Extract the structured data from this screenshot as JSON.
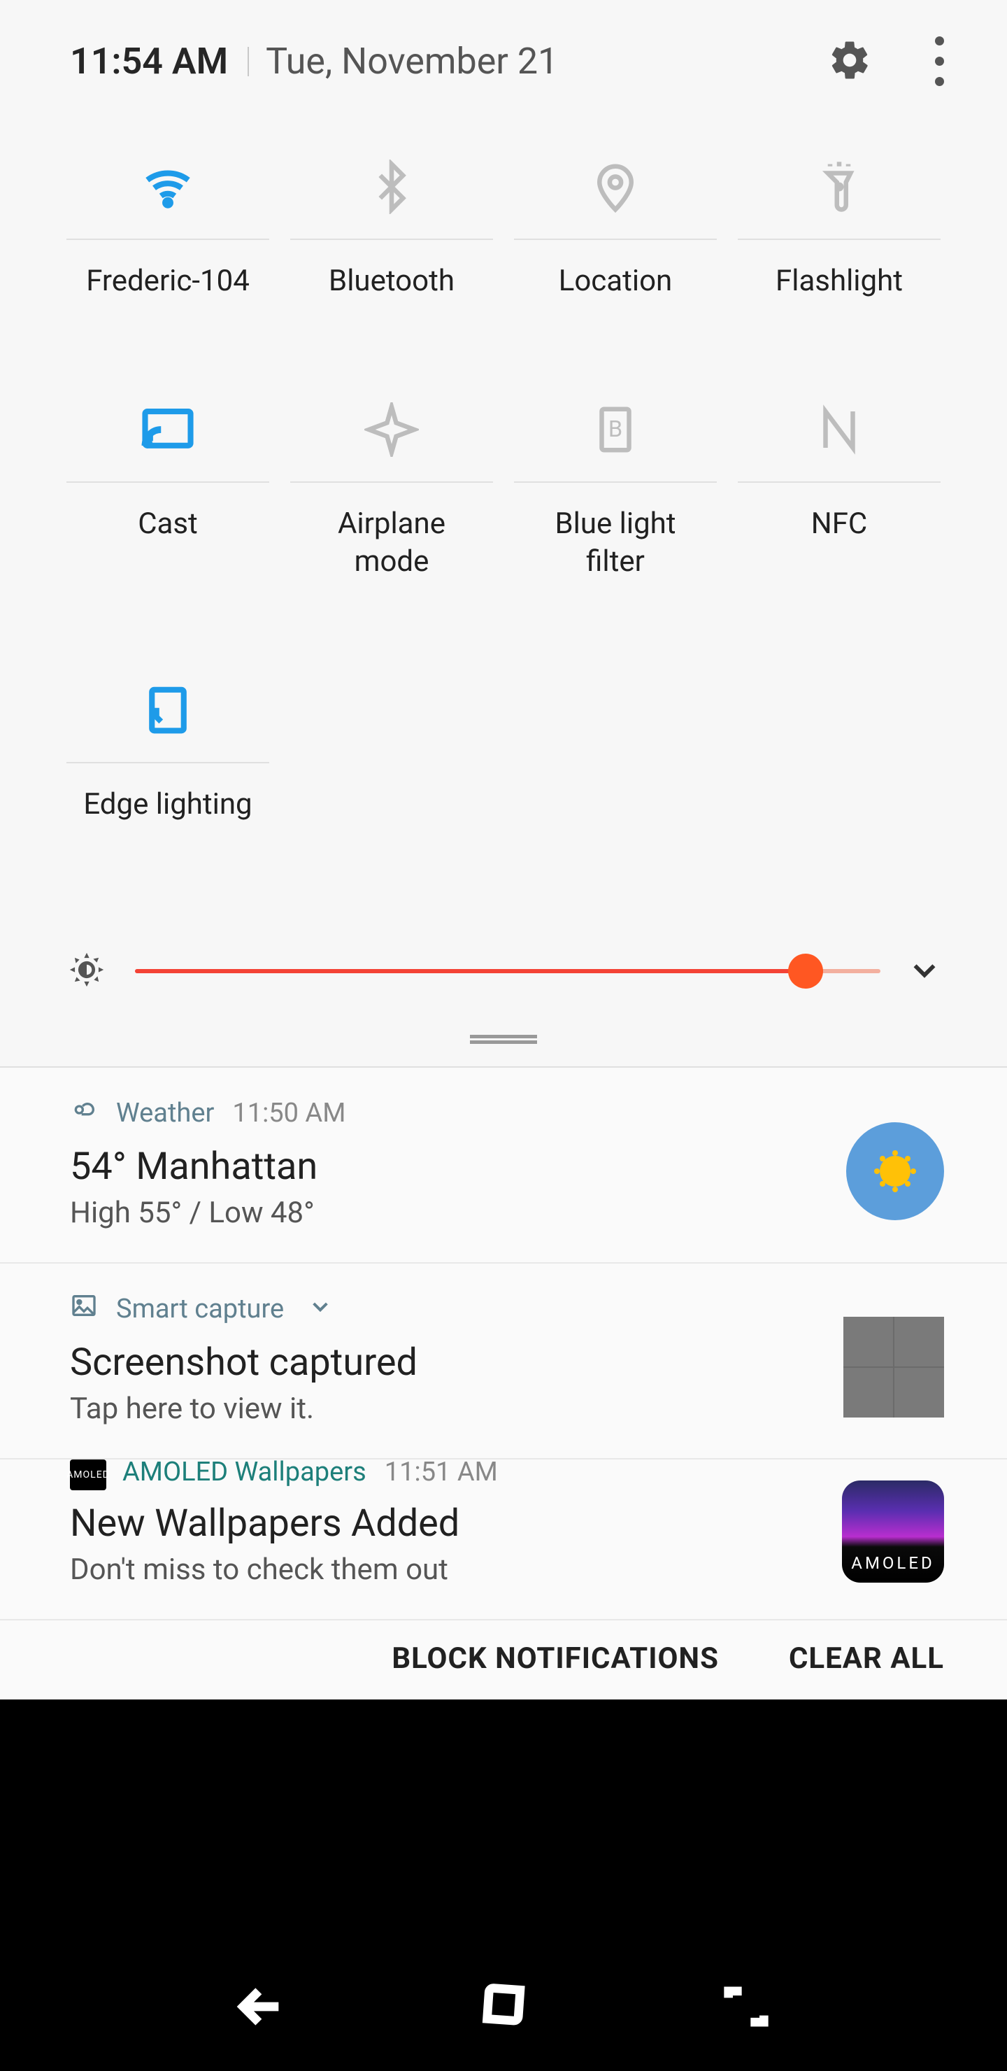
{
  "header": {
    "time": "11:54 AM",
    "date": "Tue, November 21"
  },
  "qs": {
    "tiles": [
      {
        "label": "Frederic-104",
        "icon": "wifi",
        "active": true
      },
      {
        "label": "Bluetooth",
        "icon": "bluetooth",
        "active": false
      },
      {
        "label": "Location",
        "icon": "location",
        "active": false
      },
      {
        "label": "Flashlight",
        "icon": "flashlight",
        "active": false
      },
      {
        "label": "Cast",
        "icon": "cast",
        "active": true
      },
      {
        "label": "Airplane\nmode",
        "icon": "airplane",
        "active": false
      },
      {
        "label": "Blue light\nfilter",
        "icon": "bluelight",
        "active": false
      },
      {
        "label": "NFC",
        "icon": "nfc",
        "active": false
      },
      {
        "label": "Edge lighting",
        "icon": "edge",
        "active": true
      }
    ]
  },
  "brightness": {
    "percent": 90
  },
  "notifications": [
    {
      "app": "Weather",
      "time": "11:50 AM",
      "title": "54° Manhattan",
      "text": "High 55° / Low 48°",
      "kind": "weather"
    },
    {
      "app": "Smart capture",
      "time": "",
      "title": "Screenshot captured",
      "text": "Tap here to view it.",
      "kind": "screenshot"
    },
    {
      "app": "AMOLED Wallpapers",
      "time": "11:51 AM",
      "title": "New Wallpapers Added",
      "text": "Don't miss to check them out",
      "kind": "amoled"
    }
  ],
  "footer": {
    "block": "BLOCK NOTIFICATIONS",
    "clear": "CLEAR ALL"
  },
  "amoled_badge": "AMOLED"
}
